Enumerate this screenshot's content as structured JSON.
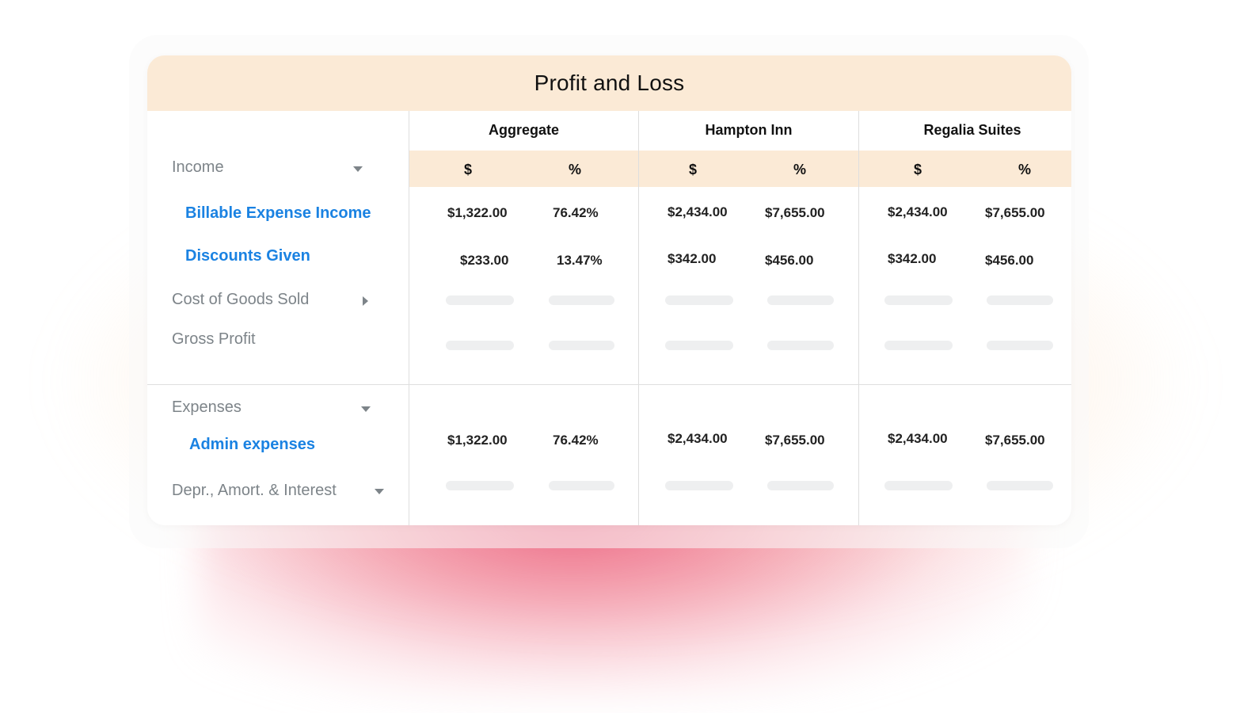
{
  "report": {
    "title": "Profit and Loss",
    "columns": [
      {
        "name": "Aggregate",
        "sub": [
          "$",
          "%"
        ]
      },
      {
        "name": "Hampton Inn",
        "sub": [
          "$",
          "%"
        ]
      },
      {
        "name": "Regalia Suites",
        "sub": [
          "$",
          "%"
        ]
      }
    ],
    "rows": {
      "income": {
        "label": "Income",
        "caret": "caret-down-icon"
      },
      "billable": {
        "label": "Billable Expense Income",
        "values": [
          "$1,322.00",
          "76.42%",
          "$2,434.00",
          "$7,655.00",
          "$2,434.00",
          "$7,655.00"
        ]
      },
      "discounts": {
        "label": "Discounts Given",
        "values": [
          "$233.00",
          "13.47%",
          "$342.00",
          "$456.00",
          "$342.00",
          "$456.00"
        ]
      },
      "cogs": {
        "label": "Cost of Goods Sold",
        "caret": "caret-right-icon"
      },
      "gross": {
        "label": "Gross Profit"
      },
      "expenses": {
        "label": "Expenses",
        "caret": "caret-down-icon"
      },
      "admin": {
        "label": "Admin expenses",
        "values": [
          "$1,322.00",
          "76.42%",
          "$2,434.00",
          "$7,655.00",
          "$2,434.00",
          "$7,655.00"
        ]
      },
      "depr": {
        "label": "Depr., Amort. & Interest",
        "caret": "caret-down-icon"
      }
    }
  },
  "colors": {
    "header_bg": "#fbead6",
    "link": "#1a82e2",
    "muted_label": "#7d8489",
    "value_text": "#222222",
    "skeleton": "#eeeff0"
  }
}
